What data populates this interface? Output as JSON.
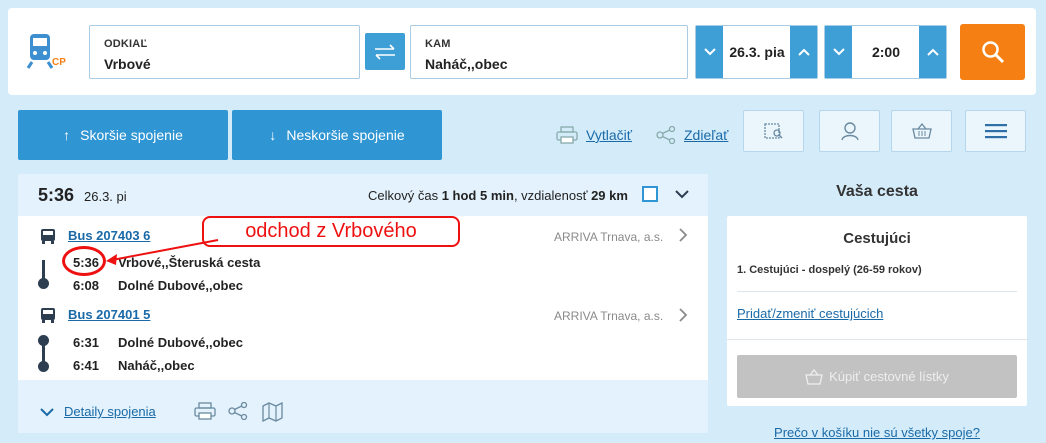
{
  "search": {
    "from_label": "ODKIAĽ",
    "from_value": "Vrbové",
    "to_label": "KAM",
    "to_value": "Naháč,,obec",
    "date_value": "26.3. pia",
    "time_value": "2:00",
    "logo_text": "CP"
  },
  "toolbar": {
    "earlier_label": "Skoršie spojenie",
    "later_label": "Neskoršie spojenie",
    "print_label": "Vytlačiť",
    "share_label": "Zdieľať"
  },
  "connection": {
    "departure_time": "5:36",
    "date": "26.3. pi",
    "summary_prefix": "Celkový čas ",
    "total_time": "1 hod 5 min",
    "summary_mid": ", vzdialenosť ",
    "distance": "29 km",
    "legs": [
      {
        "bus": "Bus 207403 6",
        "operator": "ARRIVA Trnava, a.s.",
        "stops": [
          {
            "time": "5:36",
            "name": "Vrbové,,Šteruská cesta"
          },
          {
            "time": "6:08",
            "name": "Dolné Dubové,,obec"
          }
        ]
      },
      {
        "bus": "Bus 207401 5",
        "operator": "ARRIVA Trnava, a.s.",
        "stops": [
          {
            "time": "6:31",
            "name": "Dolné Dubové,,obec"
          },
          {
            "time": "6:41",
            "name": "Naháč,,obec"
          }
        ]
      }
    ],
    "details_label": "Detaily spojenia",
    "annotation": "odchod z Vrbového"
  },
  "panel": {
    "title": "Vaša cesta",
    "passengers_heading": "Cestujúci",
    "passenger_line": "1. Cestujúci - dospelý (26-59 rokov)",
    "change_link": "Pridať/zmeniť cestujúcich",
    "buy_label": "Kúpiť cestovné lístky",
    "why_link": "Prečo v košíku nie sú všetky spoje?"
  },
  "colors": {
    "accent_blue": "#2f95d3",
    "search_orange": "#f57f12",
    "background": "#d4ecfa",
    "annotation_red": "#e11"
  }
}
